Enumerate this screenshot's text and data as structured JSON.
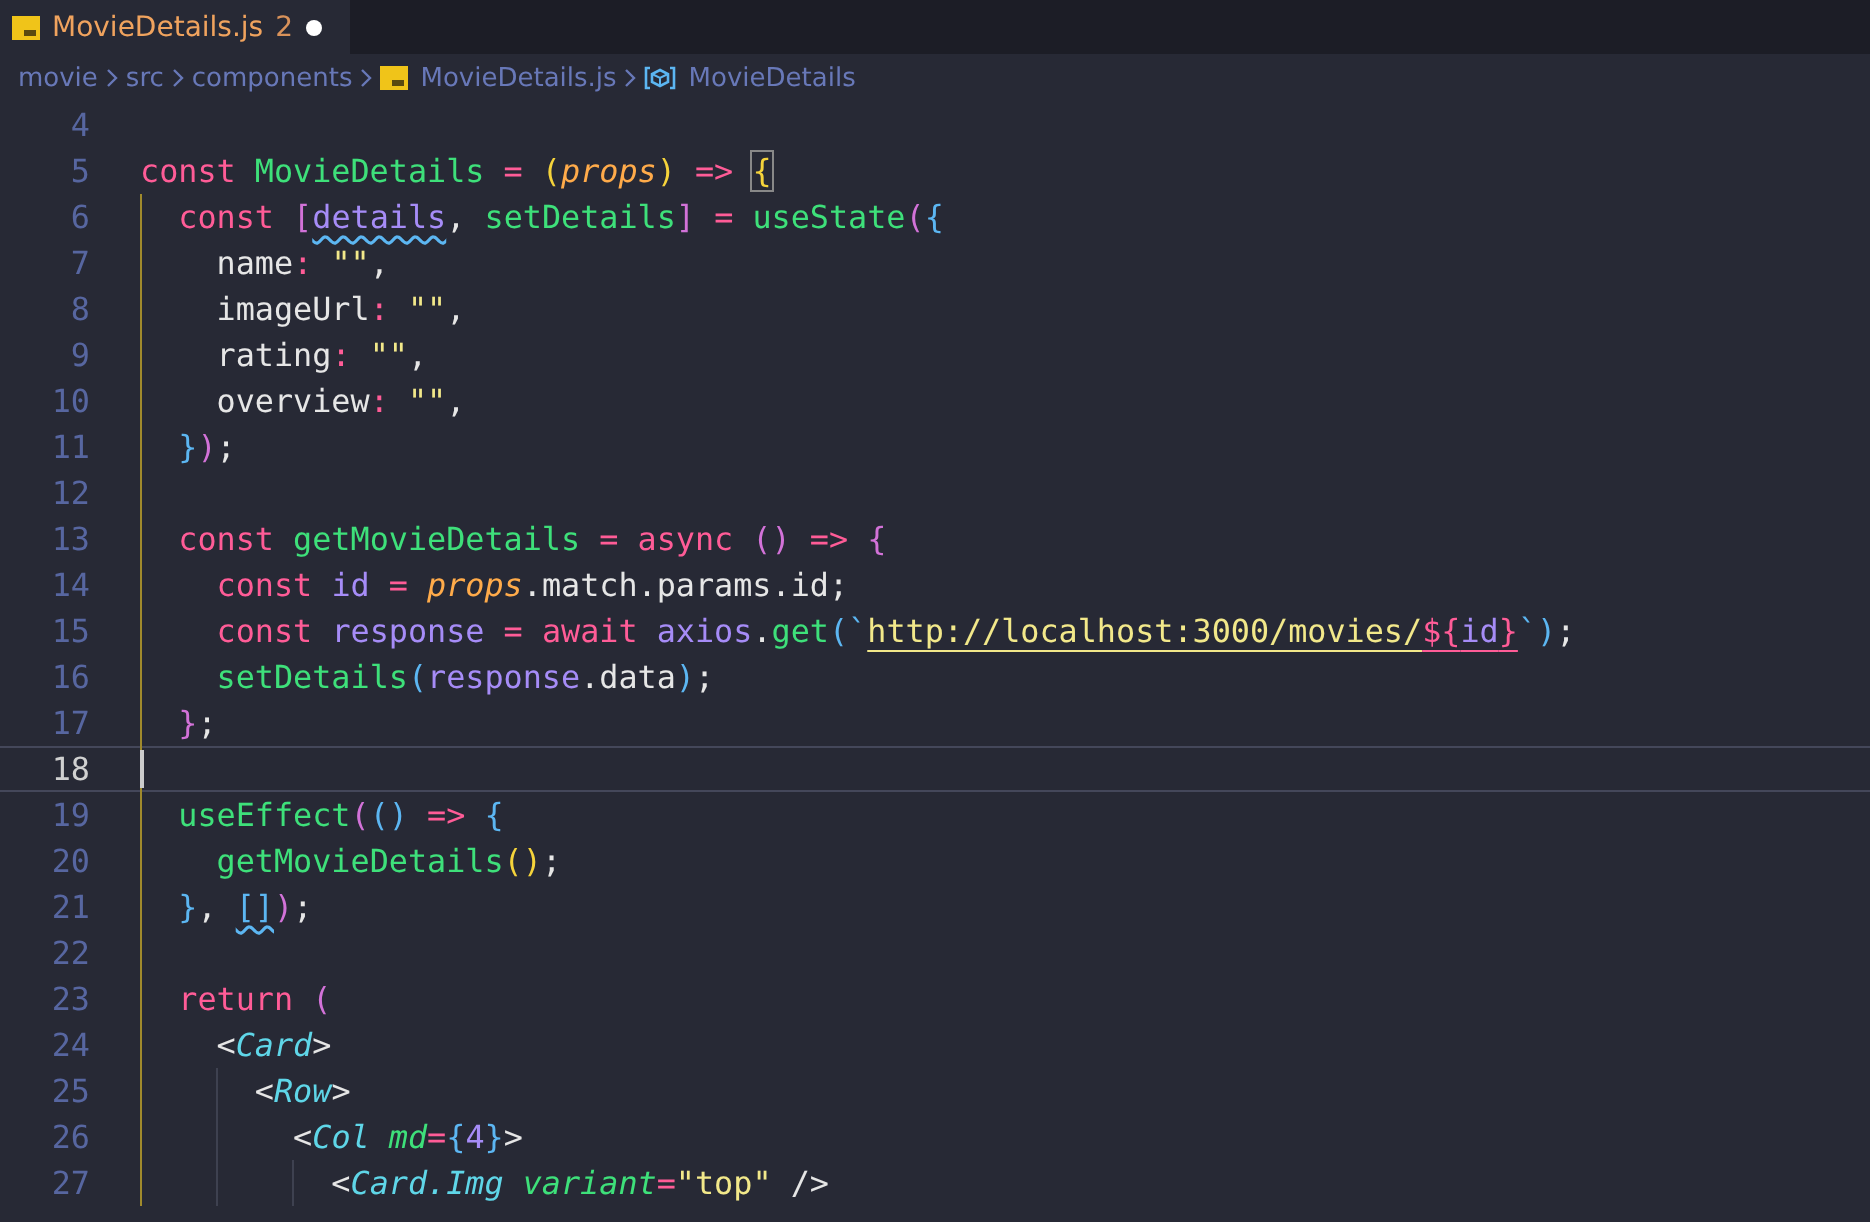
{
  "tabs": [
    {
      "label": "MovieDetails.js",
      "problems": "2",
      "modified": true,
      "selected": true
    }
  ],
  "breadcrumb": [
    {
      "kind": "folder",
      "label": "movie"
    },
    {
      "kind": "folder",
      "label": "src"
    },
    {
      "kind": "folder",
      "label": "components"
    },
    {
      "kind": "file",
      "label": "MovieDetails.js"
    },
    {
      "kind": "symbol",
      "label": "MovieDetails"
    }
  ],
  "lines": [
    {
      "number": "4"
    },
    {
      "number": "5",
      "tokens": [
        {
          "text": "const ",
          "kind": "kw"
        },
        {
          "text": "MovieDetails ",
          "kind": "fn"
        },
        {
          "text": "= ",
          "kind": "op"
        },
        {
          "text": "(",
          "kind": "b1"
        },
        {
          "text": "props",
          "kind": "param"
        },
        {
          "text": ") ",
          "kind": "b1"
        },
        {
          "text": "=> ",
          "kind": "op"
        },
        {
          "text": "{",
          "kind": "b1",
          "match": true
        }
      ]
    },
    {
      "number": "6",
      "tokens": [
        {
          "text": "  const ",
          "kind": "kw"
        },
        {
          "text": "[",
          "kind": "b2"
        },
        {
          "text": "details",
          "kind": "var",
          "squiggle": true
        },
        {
          "text": ", ",
          "kind": "plain"
        },
        {
          "text": "setDetails",
          "kind": "fn"
        },
        {
          "text": "] ",
          "kind": "b2"
        },
        {
          "text": "= ",
          "kind": "op"
        },
        {
          "text": "useState",
          "kind": "fn"
        },
        {
          "text": "(",
          "kind": "b2"
        },
        {
          "text": "{",
          "kind": "b3"
        }
      ]
    },
    {
      "number": "7",
      "tokens": [
        {
          "text": "    name",
          "kind": "plain"
        },
        {
          "text": ": ",
          "kind": "op"
        },
        {
          "text": "\"\"",
          "kind": "str"
        },
        {
          "text": ",",
          "kind": "plain"
        }
      ]
    },
    {
      "number": "8",
      "tokens": [
        {
          "text": "    imageUrl",
          "kind": "plain"
        },
        {
          "text": ": ",
          "kind": "op"
        },
        {
          "text": "\"\"",
          "kind": "str"
        },
        {
          "text": ",",
          "kind": "plain"
        }
      ]
    },
    {
      "number": "9",
      "tokens": [
        {
          "text": "    rating",
          "kind": "plain"
        },
        {
          "text": ": ",
          "kind": "op"
        },
        {
          "text": "\"\"",
          "kind": "str"
        },
        {
          "text": ",",
          "kind": "plain"
        }
      ]
    },
    {
      "number": "10",
      "tokens": [
        {
          "text": "    overview",
          "kind": "plain"
        },
        {
          "text": ": ",
          "kind": "op"
        },
        {
          "text": "\"\"",
          "kind": "str"
        },
        {
          "text": ",",
          "kind": "plain"
        }
      ]
    },
    {
      "number": "11",
      "tokens": [
        {
          "text": "  }",
          "kind": "b3"
        },
        {
          "text": ")",
          "kind": "b2"
        },
        {
          "text": ";",
          "kind": "plain"
        }
      ]
    },
    {
      "number": "12"
    },
    {
      "number": "13",
      "tokens": [
        {
          "text": "  const ",
          "kind": "kw"
        },
        {
          "text": "getMovieDetails ",
          "kind": "fn"
        },
        {
          "text": "= ",
          "kind": "op"
        },
        {
          "text": "async ",
          "kind": "kw"
        },
        {
          "text": "() ",
          "kind": "b2"
        },
        {
          "text": "=> ",
          "kind": "op"
        },
        {
          "text": "{",
          "kind": "b2"
        }
      ]
    },
    {
      "number": "14",
      "tokens": [
        {
          "text": "    const ",
          "kind": "kw"
        },
        {
          "text": "id ",
          "kind": "var"
        },
        {
          "text": "= ",
          "kind": "op"
        },
        {
          "text": "props",
          "kind": "param"
        },
        {
          "text": ".match.params.id;",
          "kind": "plain"
        }
      ]
    },
    {
      "number": "15",
      "tokens": [
        {
          "text": "    const ",
          "kind": "kw"
        },
        {
          "text": "response ",
          "kind": "var"
        },
        {
          "text": "= ",
          "kind": "op"
        },
        {
          "text": "await ",
          "kind": "kw"
        },
        {
          "text": "axios",
          "kind": "var"
        },
        {
          "text": ".",
          "kind": "plain"
        },
        {
          "text": "get",
          "kind": "fn"
        },
        {
          "text": "(",
          "kind": "b3"
        },
        {
          "text": "`",
          "kind": "tick"
        },
        {
          "text": "http://localhost:3000/movies/",
          "kind": "url"
        },
        {
          "text": "${",
          "kind": "interp"
        },
        {
          "text": "id",
          "kind": "interpvar"
        },
        {
          "text": "}",
          "kind": "interp"
        },
        {
          "text": "`",
          "kind": "tick"
        },
        {
          "text": ")",
          "kind": "b3"
        },
        {
          "text": ";",
          "kind": "plain"
        }
      ]
    },
    {
      "number": "16",
      "tokens": [
        {
          "text": "    setDetails",
          "kind": "fn"
        },
        {
          "text": "(",
          "kind": "b3"
        },
        {
          "text": "response",
          "kind": "var"
        },
        {
          "text": ".data",
          "kind": "plain"
        },
        {
          "text": ")",
          "kind": "b3"
        },
        {
          "text": ";",
          "kind": "plain"
        }
      ]
    },
    {
      "number": "17",
      "tokens": [
        {
          "text": "  }",
          "kind": "b2"
        },
        {
          "text": ";",
          "kind": "plain"
        }
      ]
    },
    {
      "number": "18",
      "current": true
    },
    {
      "number": "19",
      "tokens": [
        {
          "text": "  useEffect",
          "kind": "fn"
        },
        {
          "text": "(",
          "kind": "b2"
        },
        {
          "text": "() ",
          "kind": "b3"
        },
        {
          "text": "=> ",
          "kind": "op"
        },
        {
          "text": "{",
          "kind": "b3"
        }
      ]
    },
    {
      "number": "20",
      "tokens": [
        {
          "text": "    getMovieDetails",
          "kind": "fn"
        },
        {
          "text": "()",
          "kind": "b1"
        },
        {
          "text": ";",
          "kind": "plain"
        }
      ]
    },
    {
      "number": "21",
      "tokens": [
        {
          "text": "  }",
          "kind": "b3"
        },
        {
          "text": ", ",
          "kind": "plain"
        },
        {
          "text": "[]",
          "kind": "b3",
          "squiggle": true
        },
        {
          "text": ")",
          "kind": "b2"
        },
        {
          "text": ";",
          "kind": "plain"
        }
      ]
    },
    {
      "number": "22"
    },
    {
      "number": "23",
      "tokens": [
        {
          "text": "  return ",
          "kind": "kw"
        },
        {
          "text": "(",
          "kind": "b2"
        }
      ]
    },
    {
      "number": "24",
      "tokens": [
        {
          "text": "    <",
          "kind": "plain"
        },
        {
          "text": "Card",
          "kind": "tag"
        },
        {
          "text": ">",
          "kind": "plain"
        }
      ]
    },
    {
      "number": "25",
      "tokens": [
        {
          "text": "      <",
          "kind": "plain"
        },
        {
          "text": "Row",
          "kind": "tag"
        },
        {
          "text": ">",
          "kind": "plain"
        }
      ]
    },
    {
      "number": "26",
      "tokens": [
        {
          "text": "        <",
          "kind": "plain"
        },
        {
          "text": "Col ",
          "kind": "tag"
        },
        {
          "text": "md",
          "kind": "attr"
        },
        {
          "text": "=",
          "kind": "op"
        },
        {
          "text": "{",
          "kind": "b3"
        },
        {
          "text": "4",
          "kind": "num"
        },
        {
          "text": "}",
          "kind": "b3"
        },
        {
          "text": ">",
          "kind": "plain"
        }
      ]
    },
    {
      "number": "27",
      "tokens": [
        {
          "text": "          <",
          "kind": "plain"
        },
        {
          "text": "Card.Img ",
          "kind": "tag"
        },
        {
          "text": "variant",
          "kind": "attr"
        },
        {
          "text": "=",
          "kind": "op"
        },
        {
          "text": "\"top\"",
          "kind": "str"
        },
        {
          "text": " />",
          "kind": "plain"
        }
      ]
    }
  ]
}
